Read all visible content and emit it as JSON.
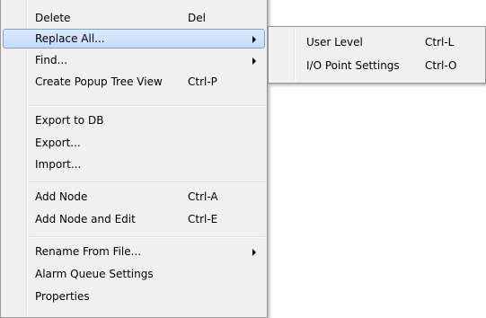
{
  "context_menu": {
    "items": [
      {
        "label": "Delete",
        "shortcut": "Del"
      },
      {
        "label": "Replace All...",
        "shortcut": ""
      },
      {
        "label": "Find...",
        "shortcut": ""
      },
      {
        "label": "Create Popup Tree View",
        "shortcut": "Ctrl-P"
      },
      {
        "label": "Export to DB",
        "shortcut": ""
      },
      {
        "label": "Export...",
        "shortcut": ""
      },
      {
        "label": "Import...",
        "shortcut": ""
      },
      {
        "label": "Add Node",
        "shortcut": "Ctrl-A"
      },
      {
        "label": "Add Node and Edit",
        "shortcut": "Ctrl-E"
      },
      {
        "label": "Rename From File...",
        "shortcut": ""
      },
      {
        "label": "Alarm Queue Settings",
        "shortcut": ""
      },
      {
        "label": "Properties",
        "shortcut": ""
      }
    ],
    "highlighted_item": "Replace All..."
  },
  "submenu": {
    "parent": "Replace All...",
    "items": [
      {
        "label": "User Level",
        "shortcut": "Ctrl-L"
      },
      {
        "label": "I/O Point Settings",
        "shortcut": "Ctrl-O"
      }
    ]
  },
  "icons": {
    "submenu_arrow": "submenu-arrow-icon"
  },
  "colors": {
    "menu_background": "#f0f0f0",
    "highlight_border": "#7da2ce",
    "highlight_fill": "#c4dcf9"
  }
}
